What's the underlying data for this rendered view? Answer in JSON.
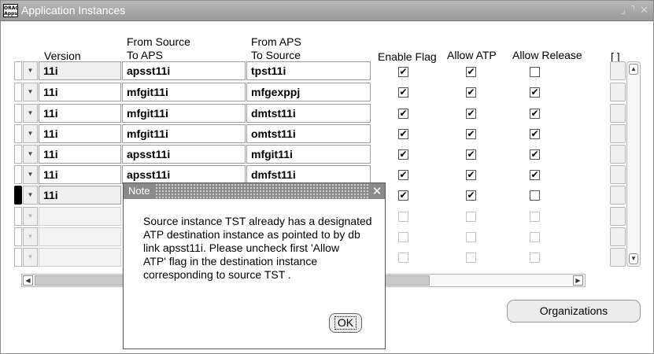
{
  "window": {
    "title": "Application Instances",
    "icon_label": "ORACLE Apps",
    "controls": [
      "⌟",
      "⌝",
      "✕"
    ]
  },
  "columns": {
    "version": "Version",
    "from_source_line1": "From Source",
    "from_source_line2": "To APS",
    "from_aps_line1": "From APS",
    "from_aps_line2": "To Source",
    "enable_flag": "Enable Flag",
    "allow_atp": "Allow ATP",
    "allow_release": "Allow Release",
    "extra": "[ ]"
  },
  "rows": [
    {
      "version": "11i",
      "from_source": "apsst11i",
      "to_source": "tpst11i",
      "enable": true,
      "atp": true,
      "release": false
    },
    {
      "version": "11i",
      "from_source": "mfgit11i",
      "to_source": "mfgexppj",
      "enable": true,
      "atp": true,
      "release": true
    },
    {
      "version": "11i",
      "from_source": "mfgit11i",
      "to_source": "dmtst11i",
      "enable": true,
      "atp": true,
      "release": true
    },
    {
      "version": "11i",
      "from_source": "mfgit11i",
      "to_source": "omtst11i",
      "enable": true,
      "atp": true,
      "release": true
    },
    {
      "version": "11i",
      "from_source": "apsst11i",
      "to_source": "mfgit11i",
      "enable": true,
      "atp": true,
      "release": true
    },
    {
      "version": "11i",
      "from_source": "apsst11i",
      "to_source": "dmfst11i",
      "enable": true,
      "atp": true,
      "release": true
    },
    {
      "version": "11i",
      "from_source": "",
      "to_source": "",
      "enable": true,
      "atp": true,
      "release": false
    }
  ],
  "check_mark": "✔",
  "scroll_arrows": {
    "up": "▲",
    "down": "▼",
    "left": "◀",
    "right": "▶",
    "dropdown": "▼"
  },
  "organizations_button": "Organizations",
  "note": {
    "title": "Note",
    "close": "✕",
    "message_lines": [
      "Source instance TST already has a designated",
      "ATP destination instance as pointed to by db",
      "link apsst11i. Please uncheck first 'Allow",
      "ATP' flag in the destination instance",
      "corresponding to source TST ."
    ],
    "ok_label": "OK"
  }
}
